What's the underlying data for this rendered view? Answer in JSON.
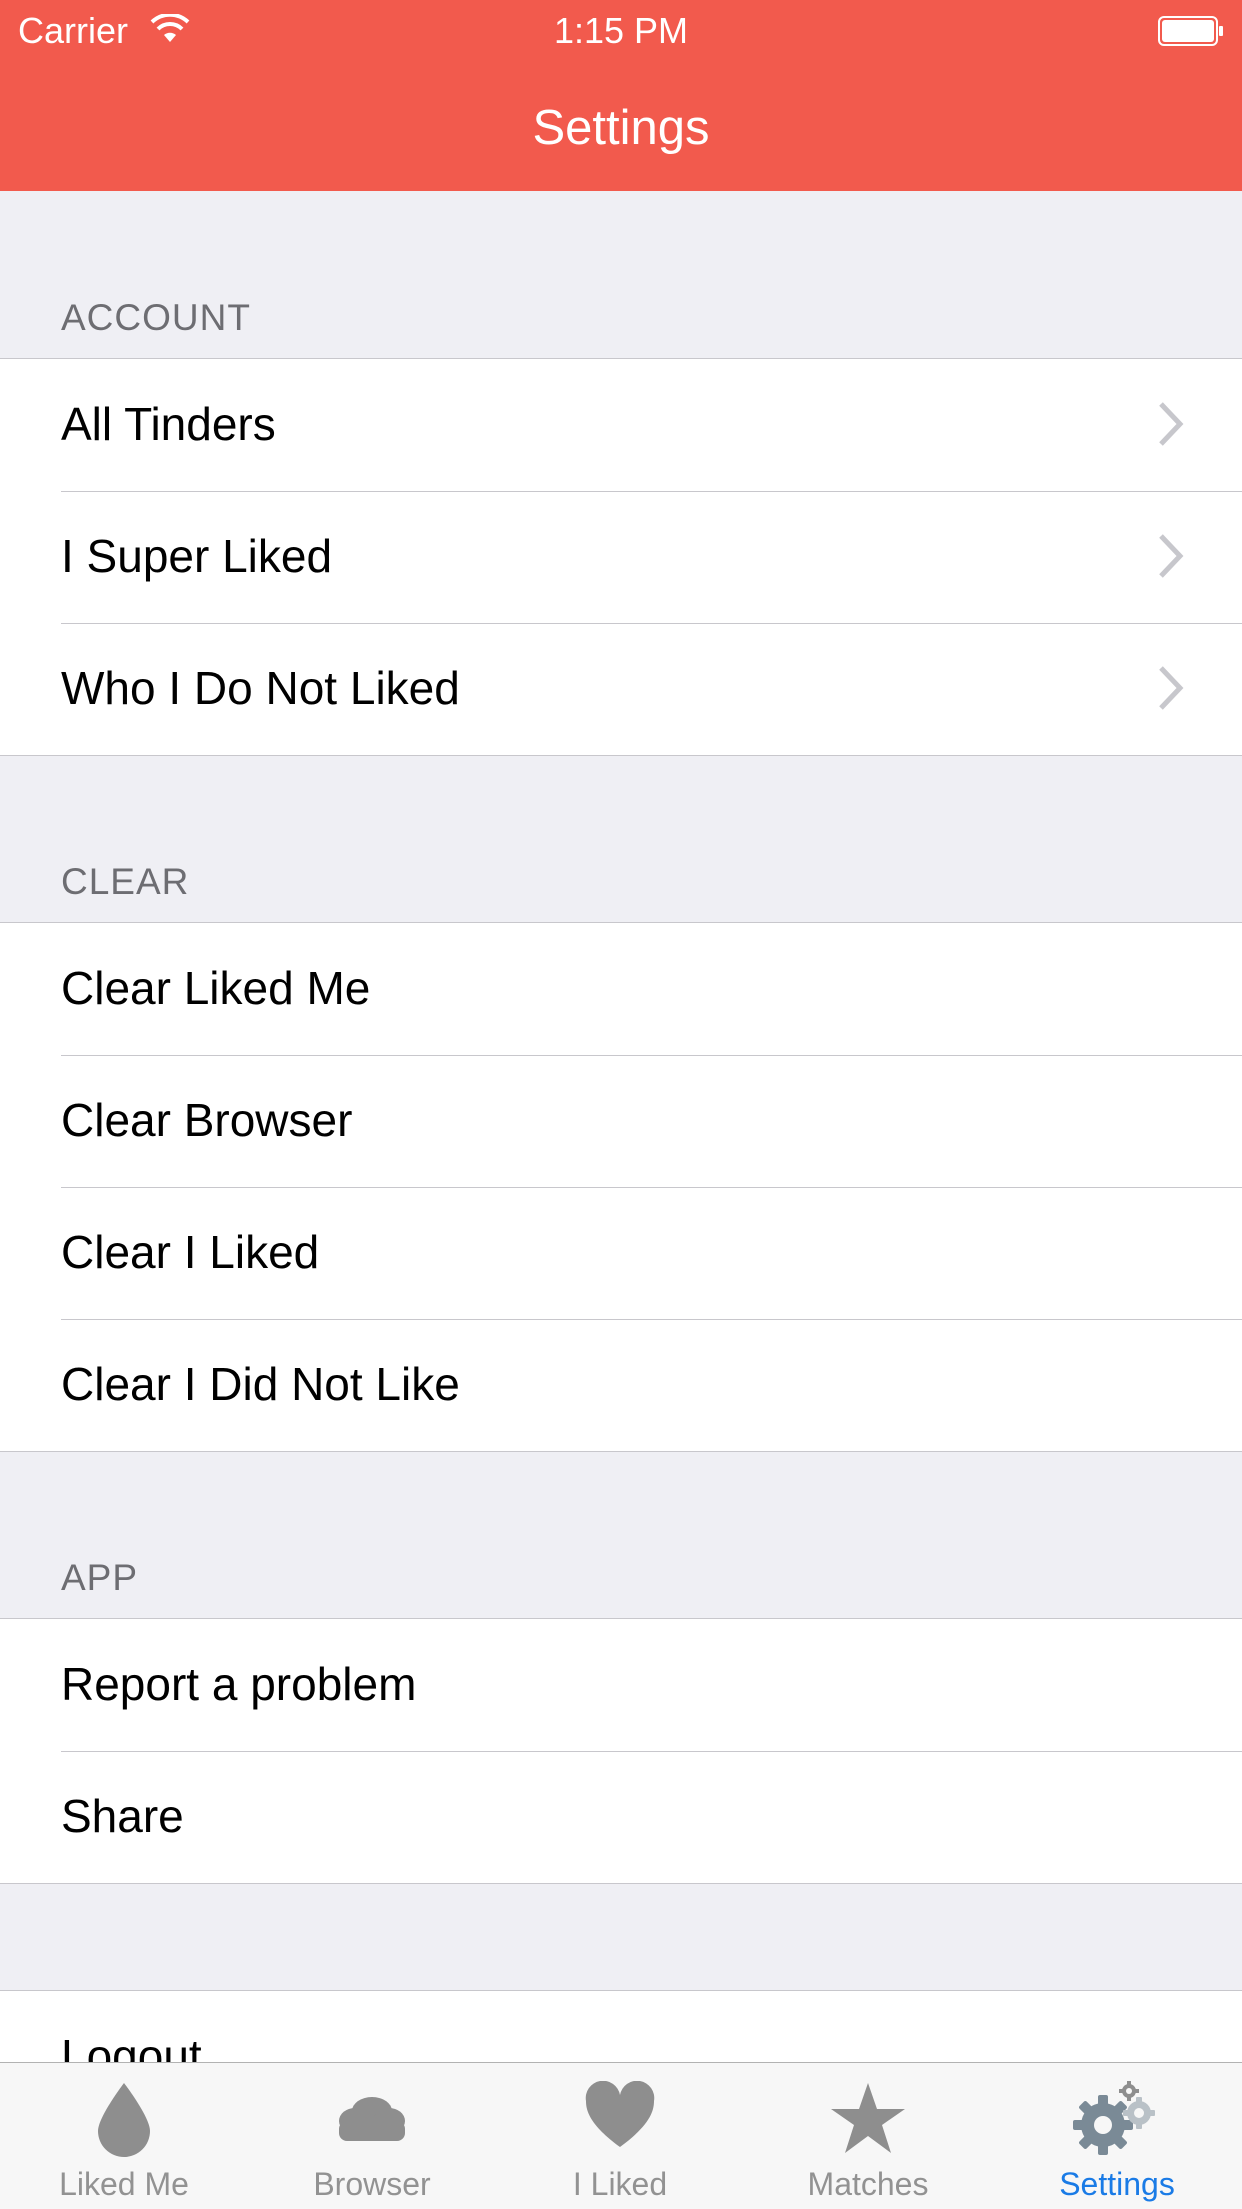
{
  "status_bar": {
    "carrier": "Carrier",
    "time": "1:15 PM"
  },
  "nav": {
    "title": "Settings"
  },
  "sections": {
    "account": {
      "header": "ACCOUNT",
      "items": [
        {
          "label": "All Tinders"
        },
        {
          "label": "I Super Liked"
        },
        {
          "label": "Who I Do Not Liked"
        }
      ]
    },
    "clear": {
      "header": "CLEAR",
      "items": [
        {
          "label": "Clear Liked Me"
        },
        {
          "label": "Clear Browser"
        },
        {
          "label": "Clear I Liked"
        },
        {
          "label": "Clear I Did Not Like"
        }
      ]
    },
    "app": {
      "header": "APP",
      "items": [
        {
          "label": "Report a problem"
        },
        {
          "label": "Share"
        }
      ]
    },
    "logout": {
      "label": "Logout"
    }
  },
  "tabbar": {
    "active": "Settings",
    "active_color": "#1a7be6",
    "inactive_color": "#929292",
    "tabs": [
      {
        "label": "Liked Me",
        "icon": "drop-icon"
      },
      {
        "label": "Browser",
        "icon": "cloud-icon"
      },
      {
        "label": "I Liked",
        "icon": "heart-icon"
      },
      {
        "label": "Matches",
        "icon": "star-icon"
      },
      {
        "label": "Settings",
        "icon": "gears-icon"
      }
    ]
  },
  "theme": {
    "nav_color": "#f25a4d",
    "background": "#efeff4"
  }
}
